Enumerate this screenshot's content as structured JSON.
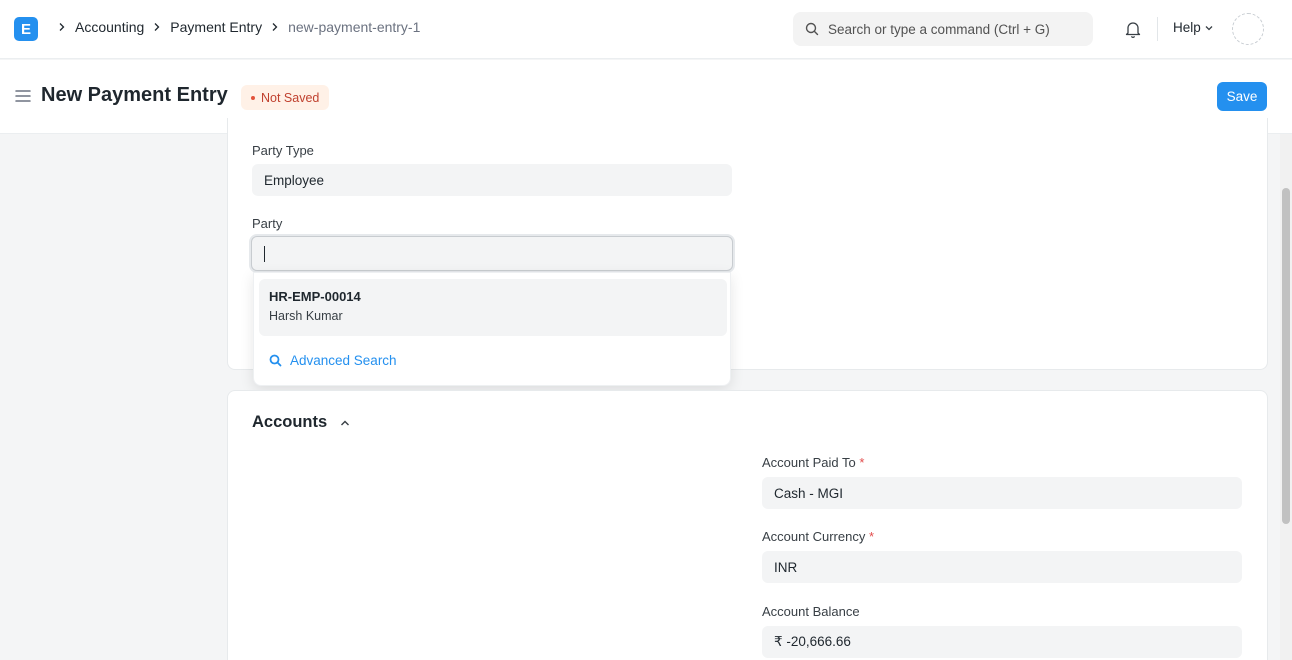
{
  "navbar": {
    "logo_letter": "E",
    "breadcrumbs": [
      "Accounting",
      "Payment Entry",
      "new-payment-entry-1"
    ],
    "search_placeholder": "Search or type a command (Ctrl + G)",
    "help_label": "Help"
  },
  "page": {
    "title": "New Payment Entry",
    "status_badge": "Not Saved",
    "save_label": "Save"
  },
  "form": {
    "party_type_label": "Party Type",
    "party_type_value": "Employee",
    "party_label": "Party",
    "party_value": "",
    "dropdown": {
      "item_id": "HR-EMP-00014",
      "item_name": "Harsh Kumar",
      "advanced_search": "Advanced Search"
    }
  },
  "accounts": {
    "section_title": "Accounts",
    "paid_to_label": "Account Paid To",
    "paid_to_value": "Cash - MGI",
    "currency_label": "Account Currency",
    "currency_value": "INR",
    "balance_label": "Account Balance",
    "balance_value": "₹ -20,666.66"
  },
  "colors": {
    "primary": "#2490ef",
    "badge_bg": "#fff1e7",
    "badge_text": "#c0412f",
    "required": "#e24c4c"
  },
  "icons": [
    "app-logo-icon",
    "chevron-right-icon",
    "search-icon",
    "bell-icon",
    "chevron-down-icon",
    "hamburger-icon",
    "chevron-up-icon"
  ]
}
